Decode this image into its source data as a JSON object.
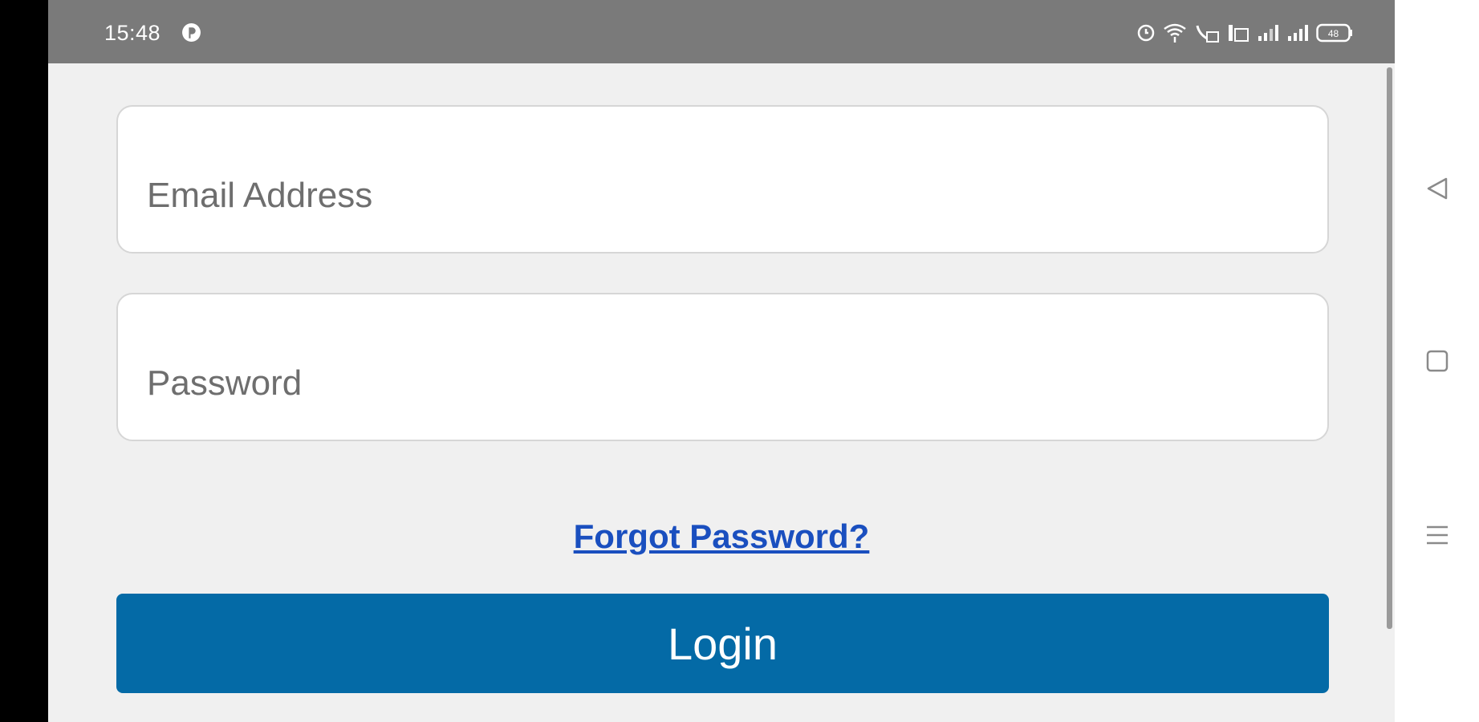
{
  "status_bar": {
    "time": "15:48",
    "battery_level": "48",
    "icons": [
      "notification-icon",
      "alarm-icon",
      "wifi-icon",
      "volte-icon",
      "data-icon",
      "signal-icon-1",
      "signal-icon-2",
      "battery-icon"
    ]
  },
  "login_form": {
    "email_placeholder": "Email Address",
    "email_value": "",
    "password_placeholder": "Password",
    "password_value": "",
    "forgot_password_label": "Forgot Password?",
    "login_label": "Login"
  },
  "nav_bar": {
    "buttons": [
      "back-icon",
      "home-icon",
      "menu-icon"
    ]
  },
  "colors": {
    "status_bar": "#7a7a7a",
    "background": "#f0f0f0",
    "link": "#1a4fbf",
    "login_button": "#046aa6"
  }
}
